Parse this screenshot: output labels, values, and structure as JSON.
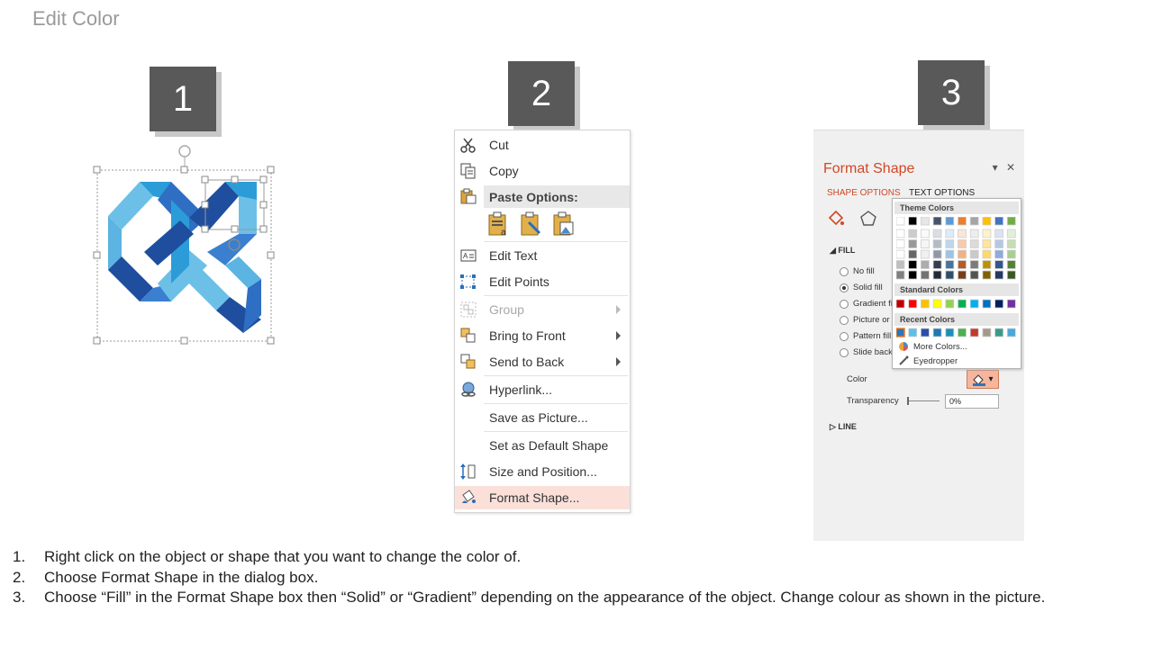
{
  "page": {
    "title": "Edit Color"
  },
  "steps": [
    {
      "number": "1"
    },
    {
      "number": "2"
    },
    {
      "number": "3"
    }
  ],
  "context_menu": {
    "items": [
      {
        "label": "Cut",
        "icon": "scissors-icon"
      },
      {
        "label": "Copy",
        "icon": "copy-icon"
      },
      {
        "label": "Paste Options:",
        "icon": "paste-icon"
      },
      {
        "label": "Edit Text",
        "icon": "edit-text-icon"
      },
      {
        "label": "Edit Points",
        "icon": "edit-points-icon"
      },
      {
        "label": "Group",
        "icon": "group-icon",
        "disabled": true
      },
      {
        "label": "Bring to Front",
        "icon": "bring-front-icon"
      },
      {
        "label": "Send to Back",
        "icon": "send-back-icon"
      },
      {
        "label": "Hyperlink...",
        "icon": "hyperlink-icon"
      },
      {
        "label": "Save as Picture...",
        "icon": ""
      },
      {
        "label": "Set as Default Shape",
        "icon": ""
      },
      {
        "label": "Size and Position...",
        "icon": "size-position-icon"
      },
      {
        "label": "Format Shape...",
        "icon": "format-shape-icon",
        "highlighted": true
      }
    ]
  },
  "format_panel": {
    "title": "Format Shape",
    "tabs": [
      "SHAPE OPTIONS",
      "TEXT OPTIONS"
    ],
    "fill_section": "FILL",
    "fill_options": [
      "No fill",
      "Solid fill",
      "Gradient fill",
      "Picture or texture fill",
      "Pattern fill",
      "Slide background fill"
    ],
    "selected_fill": "Solid fill",
    "color_label": "Color",
    "transparency_label": "Transparency",
    "transparency_value": "0%",
    "line_section": "LINE"
  },
  "color_picker": {
    "theme_label": "Theme Colors",
    "standard_label": "Standard Colors",
    "recent_label": "Recent Colors",
    "more_colors": "More Colors...",
    "eyedropper": "Eyedropper",
    "theme_colors": [
      "#FFFFFF",
      "#000000",
      "#E7E6E6",
      "#44546A",
      "#5B9BD5",
      "#ED7D31",
      "#A5A5A5",
      "#FFC000",
      "#4472C4",
      "#70AD47"
    ],
    "standard_colors": [
      "#C00000",
      "#FF0000",
      "#FFC000",
      "#FFFF00",
      "#92D050",
      "#00B050",
      "#00B0F0",
      "#0070C0",
      "#002060",
      "#7030A0"
    ],
    "recent_colors": [
      "#2E75B6",
      "#5BC0E8",
      "#2B4FA8",
      "#1F77B4",
      "#1A8FB8",
      "#4CAF50",
      "#C0392B",
      "#A5998C",
      "#3A9A8A",
      "#49A9D9"
    ]
  },
  "instructions": [
    {
      "num": "1.",
      "text": "Right click on the object or shape that you want to change the color of."
    },
    {
      "num": "2.",
      "text": "Choose Format Shape in the dialog box."
    },
    {
      "num": "3.",
      "text": "Choose “Fill” in the Format Shape box then “Solid” or “Gradient” depending on the appearance of the object. Change colour as shown in the picture."
    }
  ]
}
